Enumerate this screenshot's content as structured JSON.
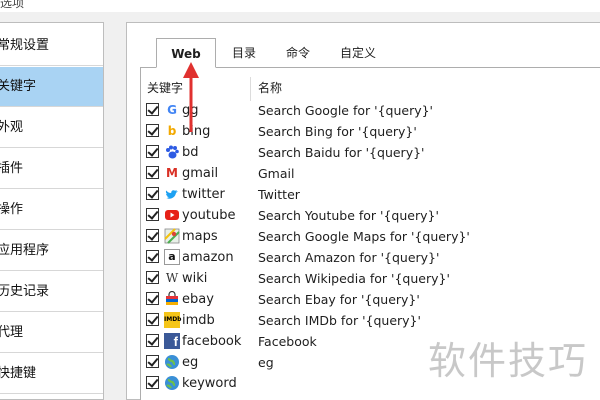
{
  "window": {
    "title_fragment": "选项"
  },
  "sidebar": {
    "items": [
      {
        "label": "常规设置",
        "selected": false
      },
      {
        "label": "关键字",
        "selected": true
      },
      {
        "label": "外观",
        "selected": false
      },
      {
        "label": "插件",
        "selected": false
      },
      {
        "label": "操作",
        "selected": false
      },
      {
        "label": "应用程序",
        "selected": false
      },
      {
        "label": "历史记录",
        "selected": false
      },
      {
        "label": "代理",
        "selected": false
      },
      {
        "label": "快捷键",
        "selected": false
      }
    ]
  },
  "tabs": [
    {
      "label": "Web",
      "active": true
    },
    {
      "label": "目录",
      "active": false
    },
    {
      "label": "命令",
      "active": false
    },
    {
      "label": "自定义",
      "active": false
    }
  ],
  "list": {
    "columns": {
      "keyword": "关键字",
      "name": "名称"
    },
    "rows": [
      {
        "keyword": "gg",
        "name": "Search Google for '{query}'",
        "icon": "google-icon",
        "checked": true
      },
      {
        "keyword": "bing",
        "name": "Search Bing for '{query}'",
        "icon": "bing-icon",
        "checked": true
      },
      {
        "keyword": "bd",
        "name": "Search Baidu for '{query}'",
        "icon": "baidu-paw-icon",
        "checked": true
      },
      {
        "keyword": "gmail",
        "name": "Gmail",
        "icon": "gmail-icon",
        "checked": true
      },
      {
        "keyword": "twitter",
        "name": "Twitter",
        "icon": "twitter-bird-icon",
        "checked": true
      },
      {
        "keyword": "youtube",
        "name": "Search Youtube for '{query}'",
        "icon": "youtube-icon",
        "checked": true
      },
      {
        "keyword": "maps",
        "name": "Search Google Maps for '{query}'",
        "icon": "maps-icon",
        "checked": true
      },
      {
        "keyword": "amazon",
        "name": "Search Amazon for '{query}'",
        "icon": "amazon-icon",
        "checked": true
      },
      {
        "keyword": "wiki",
        "name": "Search Wikipedia for '{query}'",
        "icon": "wikipedia-icon",
        "checked": true
      },
      {
        "keyword": "ebay",
        "name": "Search Ebay for '{query}'",
        "icon": "ebay-bag-icon",
        "checked": true
      },
      {
        "keyword": "imdb",
        "name": "Search IMDb for '{query}'",
        "icon": "imdb-icon",
        "checked": true
      },
      {
        "keyword": "facebook",
        "name": "Facebook",
        "icon": "facebook-icon",
        "checked": true
      },
      {
        "keyword": "eg",
        "name": "eg",
        "icon": "globe-icon",
        "checked": true
      },
      {
        "keyword": "keyword",
        "name": "",
        "icon": "globe-icon",
        "checked": true
      }
    ]
  },
  "watermark": {
    "text": "软件技巧"
  },
  "colors": {
    "selected_sidebar": "#a9d3f3",
    "arrow": "#e0312f"
  }
}
